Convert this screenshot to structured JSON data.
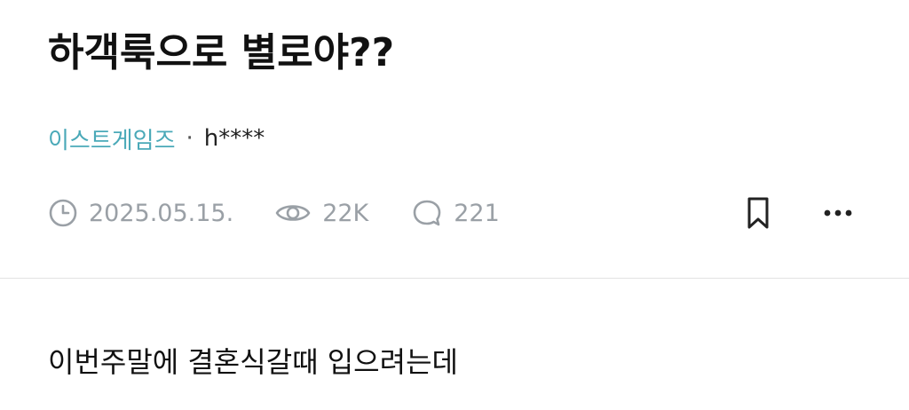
{
  "post": {
    "title": "하객룩으로 별로야??",
    "board": "이스트게임즈",
    "separator": "·",
    "author": "h****",
    "date": "2025.05.15.",
    "views": "22K",
    "comments": "221",
    "body_first_line": "이번주말에 결혼식갈때 입으려는데"
  },
  "icons": {
    "date": "clock-icon",
    "views": "eye-icon",
    "comments": "comment-bubble-icon",
    "bookmark": "bookmark-icon",
    "more": "more-dots-icon"
  },
  "colors": {
    "board_link": "#4aa9b8",
    "meta_gray": "#9aa0a6",
    "title": "#111111"
  }
}
